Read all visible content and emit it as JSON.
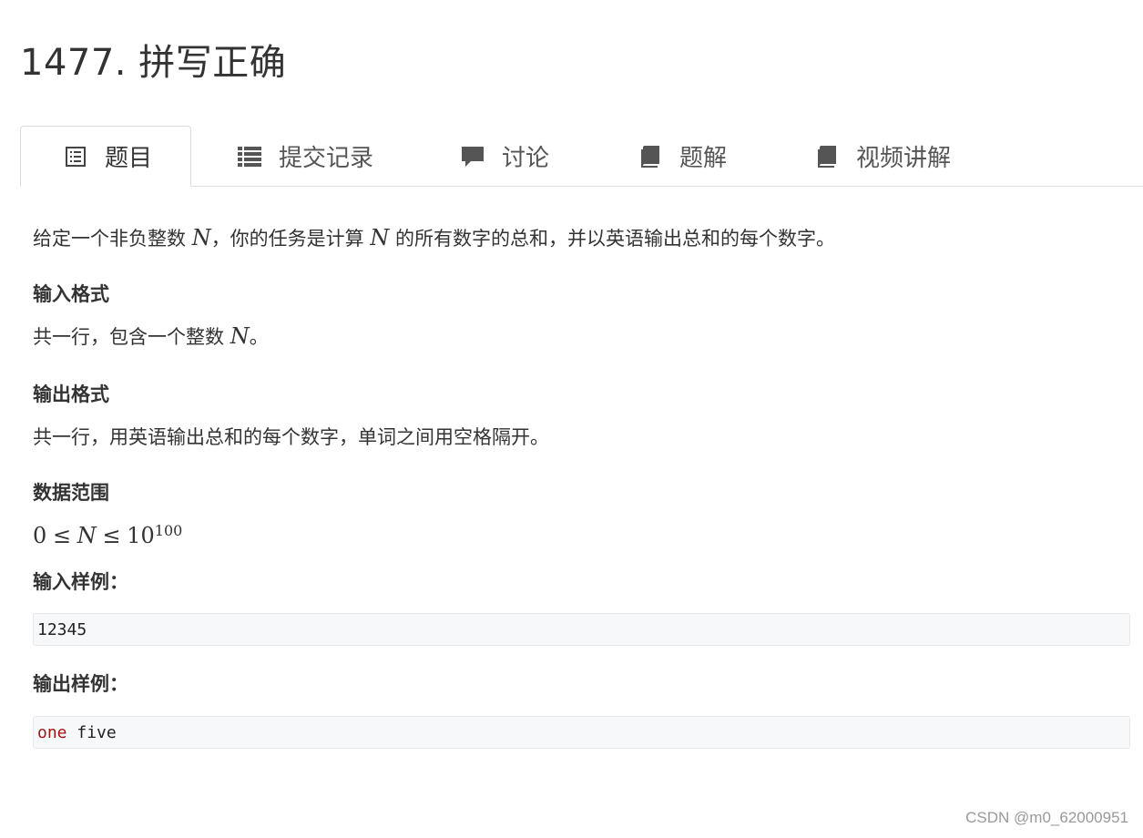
{
  "problem": {
    "title": "1477. 拼写正确"
  },
  "tabs": [
    {
      "label": "题目",
      "icon": "list-alt-icon",
      "active": true
    },
    {
      "label": "提交记录",
      "icon": "list-icon",
      "active": false
    },
    {
      "label": "讨论",
      "icon": "comment-icon",
      "active": false
    },
    {
      "label": "题解",
      "icon": "book-icon",
      "active": false
    },
    {
      "label": "视频讲解",
      "icon": "book-icon",
      "active": false
    }
  ],
  "description": {
    "part1": "给定一个非负整数 ",
    "var": "N",
    "part2": "，你的任务是计算 ",
    "part3": " 的所有数字的总和，并以英语输出总和的每个数字。"
  },
  "input_format": {
    "heading": "输入格式",
    "text_before": "共一行，包含一个整数 ",
    "var": "N",
    "text_after": "。"
  },
  "output_format": {
    "heading": "输出格式",
    "text": "共一行，用英语输出总和的每个数字，单词之间用空格隔开。"
  },
  "constraints": {
    "heading": "数据范围",
    "lower": "0",
    "leq": "≤",
    "var": "N",
    "upper_base": "10",
    "upper_exp": "100"
  },
  "sample_input": {
    "heading": "输入样例：",
    "code": "12345"
  },
  "sample_output": {
    "heading": "输出样例：",
    "code_keyword": "one",
    "code_rest": " five"
  },
  "watermark": "CSDN @m0_62000951",
  "colors": {
    "keyword": "#a31515",
    "code_bg": "#f7f8fa",
    "tab_border": "#dddddd"
  }
}
